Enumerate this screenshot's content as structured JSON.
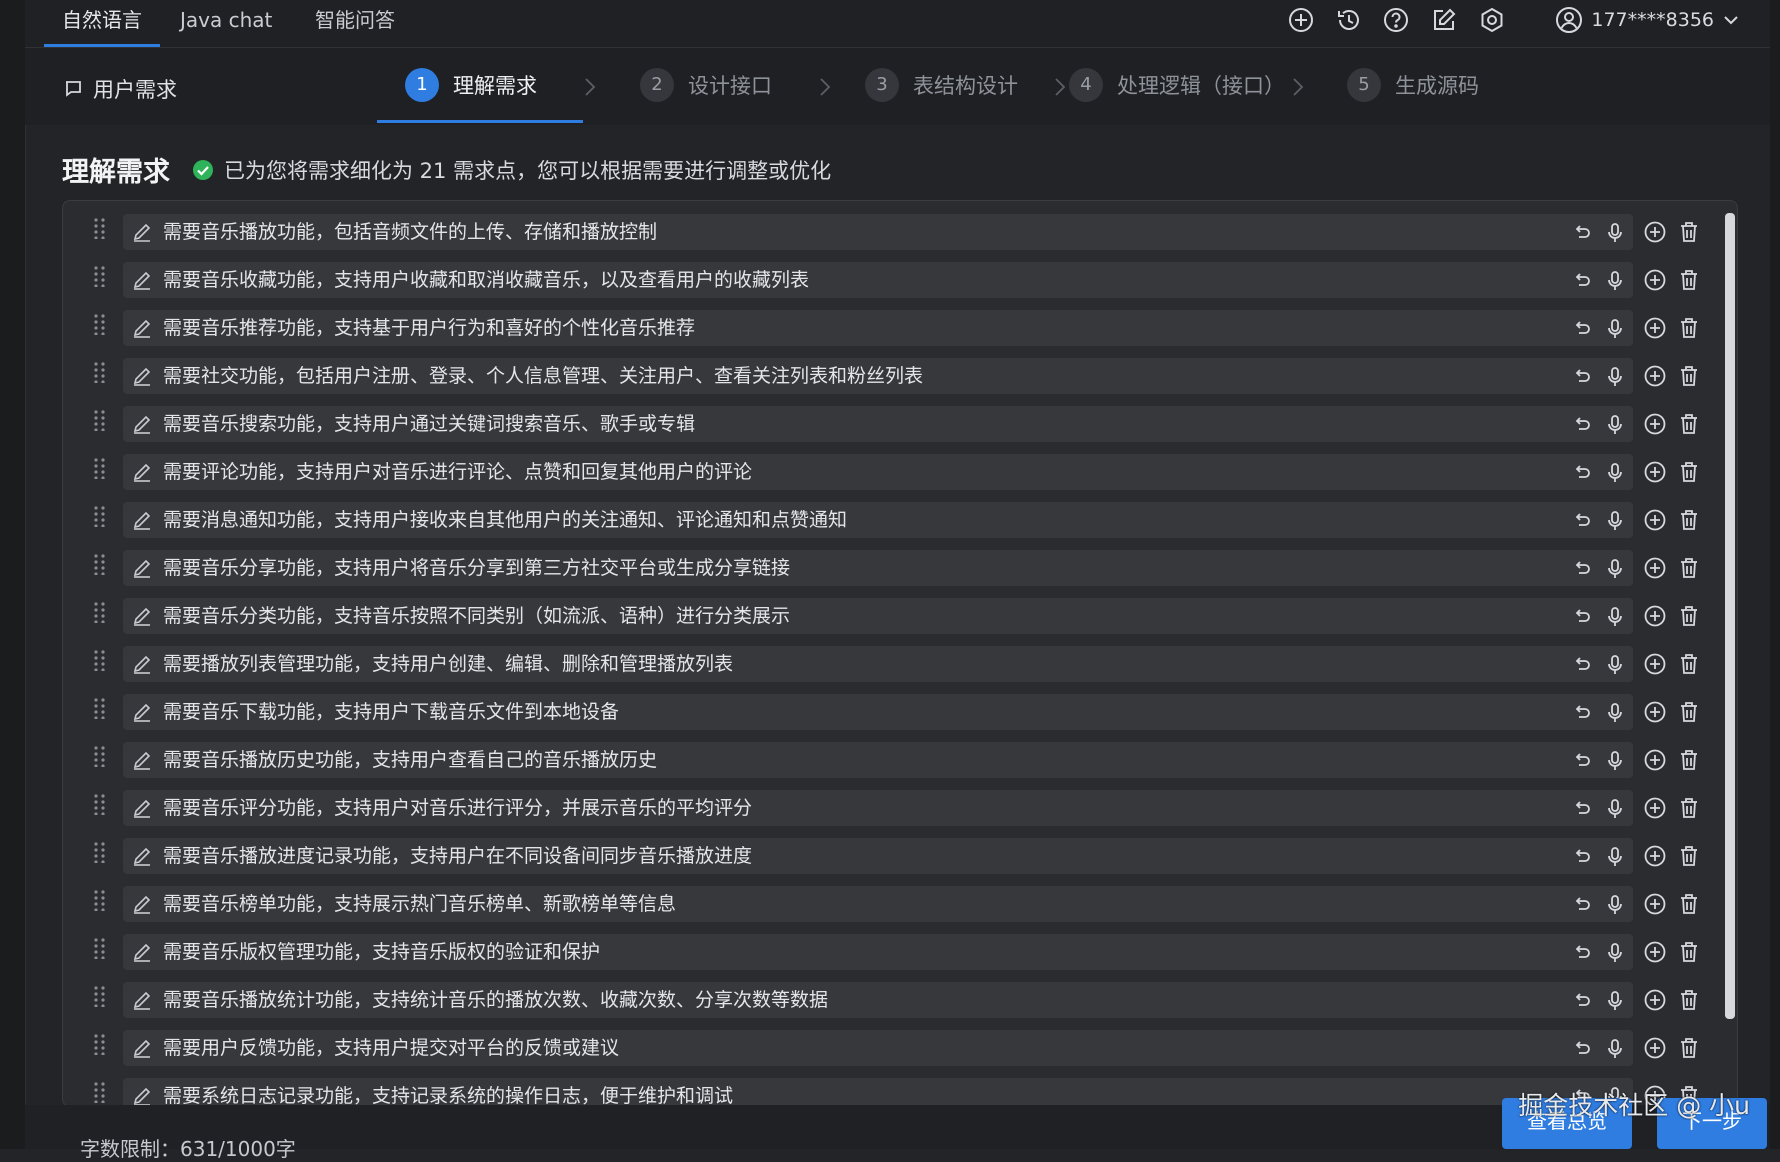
{
  "top_tabs": [
    "自然语言",
    "Java chat",
    "智能问答"
  ],
  "top_icons": [
    "add-circle-icon",
    "history-icon",
    "help-icon",
    "edit-note-icon",
    "settings-icon"
  ],
  "user": {
    "phone": "177****8356",
    "icon": "user-circle-icon"
  },
  "steps": {
    "user_req_label": "用户需求",
    "items": [
      {
        "num": "1",
        "label": "理解需求",
        "active": true
      },
      {
        "num": "2",
        "label": "设计接口"
      },
      {
        "num": "3",
        "label": "表结构设计"
      },
      {
        "num": "4",
        "label": "处理逻辑（接口）"
      },
      {
        "num": "5",
        "label": "生成源码"
      }
    ]
  },
  "heading": {
    "title": "理解需求",
    "note": "已为您将需求细化为 21 需求点，您可以根据需要进行调整或优化"
  },
  "requirements": [
    "需要音乐播放功能，包括音频文件的上传、存储和播放控制",
    "需要音乐收藏功能，支持用户收藏和取消收藏音乐，以及查看用户的收藏列表",
    "需要音乐推荐功能，支持基于用户行为和喜好的个性化音乐推荐",
    "需要社交功能，包括用户注册、登录、个人信息管理、关注用户、查看关注列表和粉丝列表",
    "需要音乐搜索功能，支持用户通过关键词搜索音乐、歌手或专辑",
    "需要评论功能，支持用户对音乐进行评论、点赞和回复其他用户的评论",
    "需要消息通知功能，支持用户接收来自其他用户的关注通知、评论通知和点赞通知",
    "需要音乐分享功能，支持用户将音乐分享到第三方社交平台或生成分享链接",
    "需要音乐分类功能，支持音乐按照不同类别（如流派、语种）进行分类展示",
    "需要播放列表管理功能，支持用户创建、编辑、删除和管理播放列表",
    "需要音乐下载功能，支持用户下载音乐文件到本地设备",
    "需要音乐播放历史功能，支持用户查看自己的音乐播放历史",
    "需要音乐评分功能，支持用户对音乐进行评分，并展示音乐的平均评分",
    "需要音乐播放进度记录功能，支持用户在不同设备间同步音乐播放进度",
    "需要音乐榜单功能，支持展示热门音乐榜单、新歌榜单等信息",
    "需要音乐版权管理功能，支持音乐版权的验证和保护",
    "需要音乐播放统计功能，支持统计音乐的播放次数、收藏次数、分享次数等数据",
    "需要用户反馈功能，支持用户提交对平台的反馈或建议",
    "需要系统日志记录功能，支持记录系统的操作日志，便于维护和调试"
  ],
  "row_icons": [
    "edit-icon",
    "undo-icon",
    "microphone-icon",
    "add-circle-icon",
    "trash-icon"
  ],
  "footer": {
    "word_limit": "字数限制：631/1000字",
    "preview_button": "查看总览",
    "next_button": "下一步"
  },
  "watermark": "掘金技术社区 @ 小u",
  "colors": {
    "accent": "#2f7de1",
    "success": "#2fb35a",
    "background": "#232427"
  }
}
